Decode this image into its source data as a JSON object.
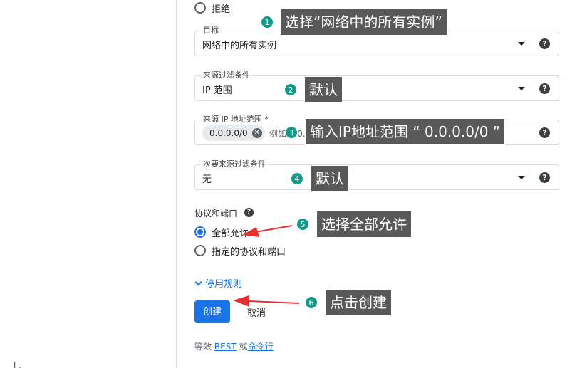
{
  "top_radio": {
    "label": "拒绝"
  },
  "fields": {
    "target": {
      "label": "目标",
      "value": "网络中的所有实例"
    },
    "source_filter": {
      "label": "来源过滤条件",
      "value": "IP 范围"
    },
    "source_ip": {
      "label": "来源 IP 地址范围 *",
      "chip": "0.0.0.0/0",
      "hint": "例如 0.0.0.0"
    },
    "secondary_filter": {
      "label": "次要来源过滤条件",
      "value": "无"
    }
  },
  "protocols": {
    "label": "协议和端口",
    "options": [
      "全部允许",
      "指定的协议和端口"
    ],
    "selected": "全部允许"
  },
  "disable_rule_label": "停用规则",
  "buttons": {
    "create": "创建",
    "cancel": "取消"
  },
  "footer": {
    "prefix": "等效",
    "rest": "REST",
    "or": "或",
    "cmd": "命令行"
  },
  "help_glyph": "?",
  "chip_close_glyph": "✕",
  "corner_glyph": "乚",
  "annotations": [
    {
      "num": "1",
      "text": "选择“网络中的所有实例”"
    },
    {
      "num": "2",
      "text": "默认"
    },
    {
      "num": "3",
      "text": "输入IP地址范围 “ 0.0.0.0/0 ”"
    },
    {
      "num": "4",
      "text": "默认"
    },
    {
      "num": "5",
      "text": "选择全部允许"
    },
    {
      "num": "6",
      "text": "点击创建"
    }
  ],
  "colors": {
    "accent": "#1a73e8",
    "badge": "#129b88",
    "callout_bg": "#595959",
    "arrow": "#e8302f"
  }
}
